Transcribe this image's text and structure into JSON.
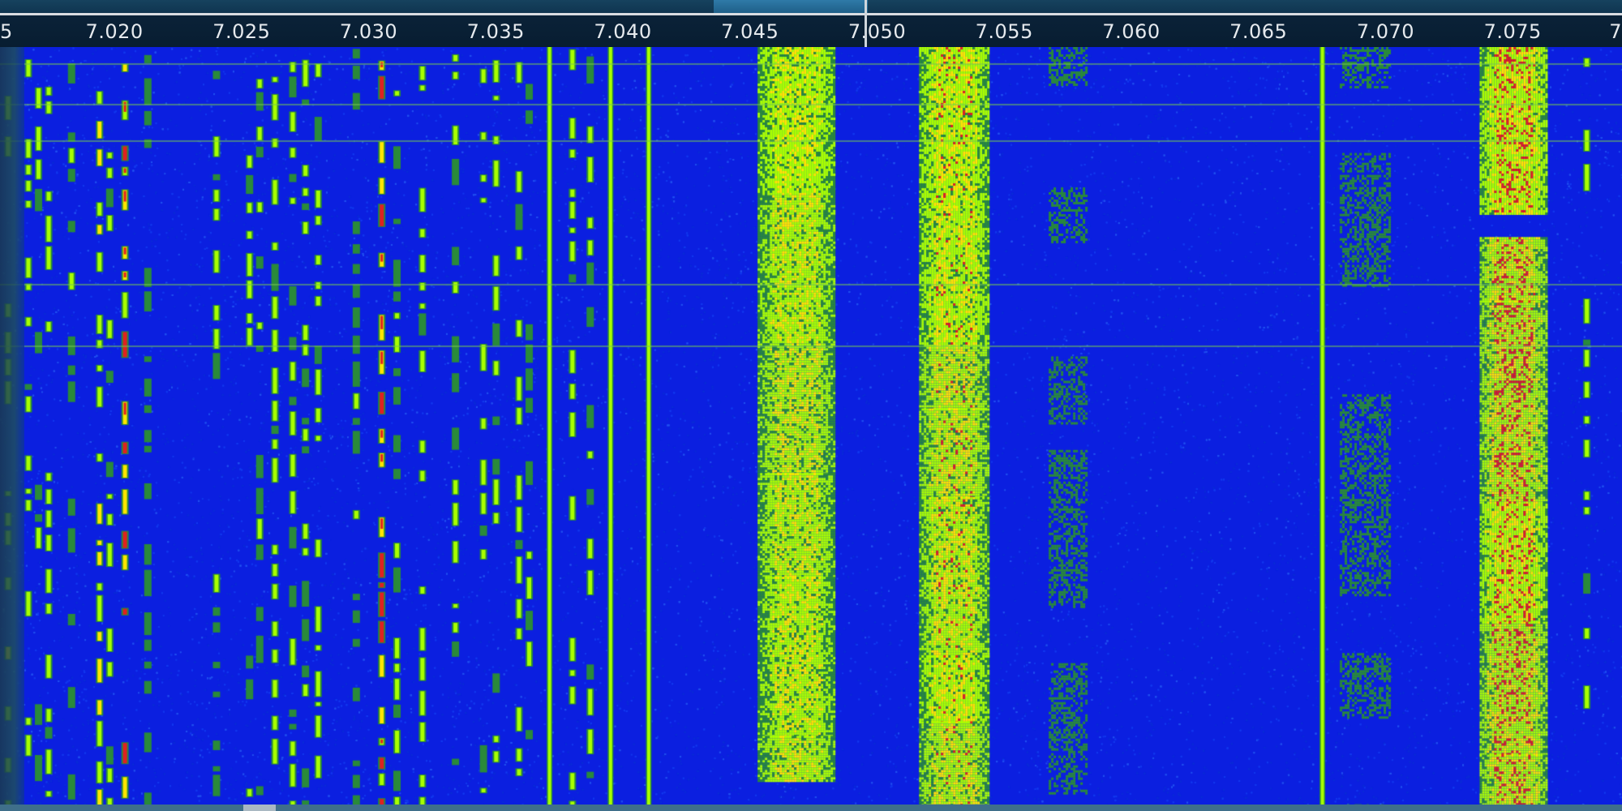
{
  "scale": {
    "ticks": [
      {
        "label": "5",
        "mhz": 7.015
      },
      {
        "label": "7.020",
        "mhz": 7.02
      },
      {
        "label": "7.025",
        "mhz": 7.025
      },
      {
        "label": "7.030",
        "mhz": 7.03
      },
      {
        "label": "7.035",
        "mhz": 7.035
      },
      {
        "label": "7.040",
        "mhz": 7.04
      },
      {
        "label": "7.045",
        "mhz": 7.045
      },
      {
        "label": "7.050",
        "mhz": 7.05
      },
      {
        "label": "7.055",
        "mhz": 7.055
      },
      {
        "label": "7.060",
        "mhz": 7.06
      },
      {
        "label": "7.065",
        "mhz": 7.065
      },
      {
        "label": "7.070",
        "mhz": 7.07
      },
      {
        "label": "7.075",
        "mhz": 7.075
      },
      {
        "label": "7",
        "mhz": 7.08
      }
    ],
    "visible_range_mhz": [
      7.0155,
      7.0793
    ]
  },
  "tuning": {
    "frequency_mhz": 7.0495
  },
  "colors": {
    "background": "#0b1fe0",
    "weak": "#2a8a3a",
    "mid": "#a8ff00",
    "strong": "#ffe600",
    "peak": "#e02020"
  },
  "waterfall": {
    "signals": [
      {
        "mhz": 7.0158,
        "type": "cw",
        "intensity": 0.7
      },
      {
        "mhz": 7.0166,
        "type": "cw",
        "intensity": 0.6
      },
      {
        "mhz": 7.017,
        "type": "cw",
        "intensity": 0.5
      },
      {
        "mhz": 7.0174,
        "type": "cw",
        "intensity": 0.6
      },
      {
        "mhz": 7.0183,
        "type": "cw",
        "intensity": 0.45
      },
      {
        "mhz": 7.0194,
        "type": "cw",
        "intensity": 0.8
      },
      {
        "mhz": 7.0198,
        "type": "cw",
        "intensity": 0.6
      },
      {
        "mhz": 7.0204,
        "type": "cw",
        "intensity": 1.0
      },
      {
        "mhz": 7.0213,
        "type": "cw",
        "intensity": 0.4
      },
      {
        "mhz": 7.024,
        "type": "cw",
        "intensity": 0.5
      },
      {
        "mhz": 7.0253,
        "type": "cw",
        "intensity": 0.55
      },
      {
        "mhz": 7.0257,
        "type": "cw",
        "intensity": 0.45
      },
      {
        "mhz": 7.0263,
        "type": "cw",
        "intensity": 0.6
      },
      {
        "mhz": 7.027,
        "type": "cw",
        "intensity": 0.5
      },
      {
        "mhz": 7.0275,
        "type": "cw",
        "intensity": 0.55
      },
      {
        "mhz": 7.028,
        "type": "cw",
        "intensity": 0.6
      },
      {
        "mhz": 7.0295,
        "type": "cw",
        "intensity": 0.45
      },
      {
        "mhz": 7.0305,
        "type": "cw",
        "intensity": 0.95
      },
      {
        "mhz": 7.0311,
        "type": "cw",
        "intensity": 0.5
      },
      {
        "mhz": 7.0321,
        "type": "cw",
        "intensity": 0.6
      },
      {
        "mhz": 7.0334,
        "type": "cw",
        "intensity": 0.5
      },
      {
        "mhz": 7.0345,
        "type": "cw",
        "intensity": 0.6
      },
      {
        "mhz": 7.035,
        "type": "cw",
        "intensity": 0.55
      },
      {
        "mhz": 7.0359,
        "type": "cw",
        "intensity": 0.6
      },
      {
        "mhz": 7.0363,
        "type": "cw",
        "intensity": 0.5
      },
      {
        "mhz": 7.0371,
        "type": "carrier",
        "intensity": 0.7
      },
      {
        "mhz": 7.038,
        "type": "cw",
        "intensity": 0.55
      },
      {
        "mhz": 7.0387,
        "type": "cw",
        "intensity": 0.5
      },
      {
        "mhz": 7.0395,
        "type": "carrier",
        "intensity": 0.7
      },
      {
        "mhz": 7.041,
        "type": "carrier",
        "intensity": 0.85
      },
      {
        "mhz": 7.0468,
        "type": "wide",
        "width_khz": 3.0,
        "intensity": 0.85
      },
      {
        "mhz": 7.053,
        "type": "wide",
        "width_khz": 2.7,
        "intensity": 0.9
      },
      {
        "mhz": 7.0575,
        "type": "faint",
        "width_khz": 1.5,
        "intensity": 0.35
      },
      {
        "mhz": 7.0675,
        "type": "carrier",
        "intensity": 0.75
      },
      {
        "mhz": 7.0692,
        "type": "faint",
        "width_khz": 2.0,
        "intensity": 0.35
      },
      {
        "mhz": 7.075,
        "type": "wide",
        "width_khz": 2.6,
        "intensity": 1.0
      },
      {
        "mhz": 7.0779,
        "type": "cw",
        "intensity": 0.55
      }
    ]
  }
}
